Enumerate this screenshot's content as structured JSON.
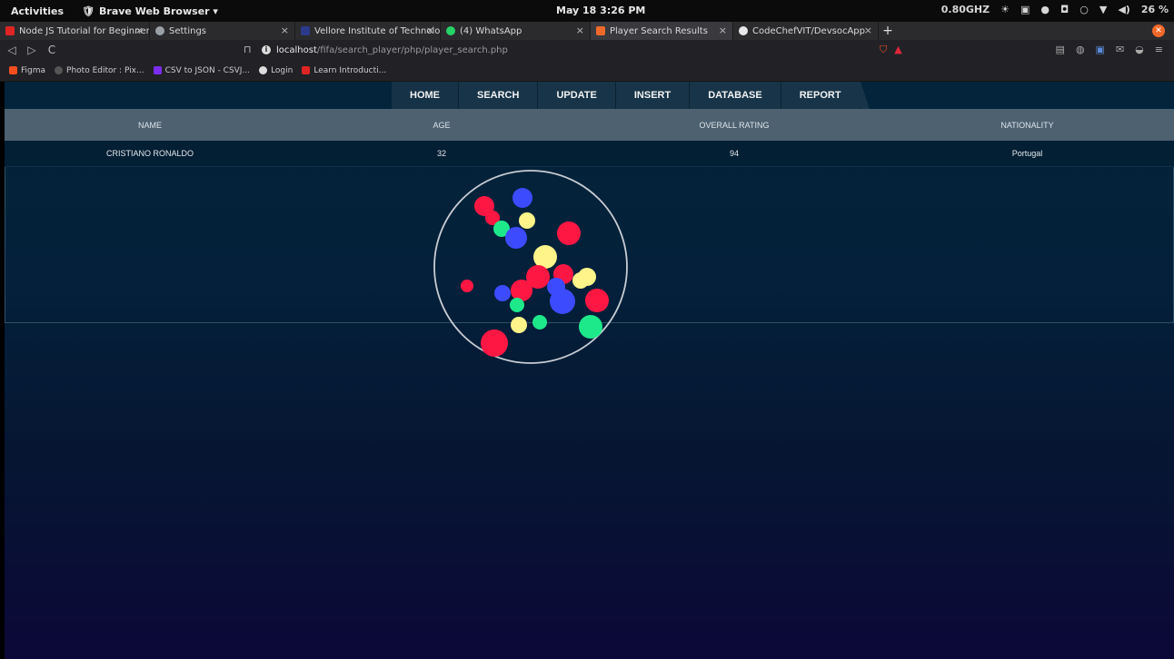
{
  "os_topbar": {
    "activities": "Activities",
    "app_name": "Brave Web Browser ▾",
    "clock": "May 18  3:26 PM",
    "cpu": "0.80GHZ",
    "battery": "26 %"
  },
  "tabs": [
    {
      "title": "Node JS Tutorial for Beginners",
      "color": "#e02424"
    },
    {
      "title": "Settings",
      "color": "#9aa0a6"
    },
    {
      "title": "Vellore Institute of Technology",
      "color": "#2b3a8a"
    },
    {
      "title": "(4) WhatsApp",
      "color": "#25d366"
    },
    {
      "title": "Player Search Results",
      "color": "#f0692a"
    },
    {
      "title": "CodeChefVIT/DevsocApp",
      "color": "#e8e8e8"
    }
  ],
  "address": {
    "host": "localhost",
    "path": "/fifa/search_player/php/player_search.php"
  },
  "bookmarks": [
    {
      "label": "Figma",
      "color": "#f24e1e"
    },
    {
      "label": "Photo Editor : Pix...",
      "color": "#666666"
    },
    {
      "label": "CSV to JSON - CSVJ...",
      "color": "#7b2cf0"
    },
    {
      "label": "Login",
      "color": "#dddddd"
    },
    {
      "label": "Learn Introducti...",
      "color": "#e02424"
    }
  ],
  "nav": {
    "home": "HOME",
    "search": "SEARCH",
    "update": "UPDATE",
    "insert": "INSERT",
    "database": "DATABASE",
    "report": "REPORT"
  },
  "table": {
    "headers": [
      "NAME",
      "AGE",
      "OVERALL RATING",
      "NATIONALITY"
    ],
    "rows": [
      [
        "CRISTIANO RONALDO",
        "32",
        "94",
        "Portugal"
      ]
    ]
  }
}
